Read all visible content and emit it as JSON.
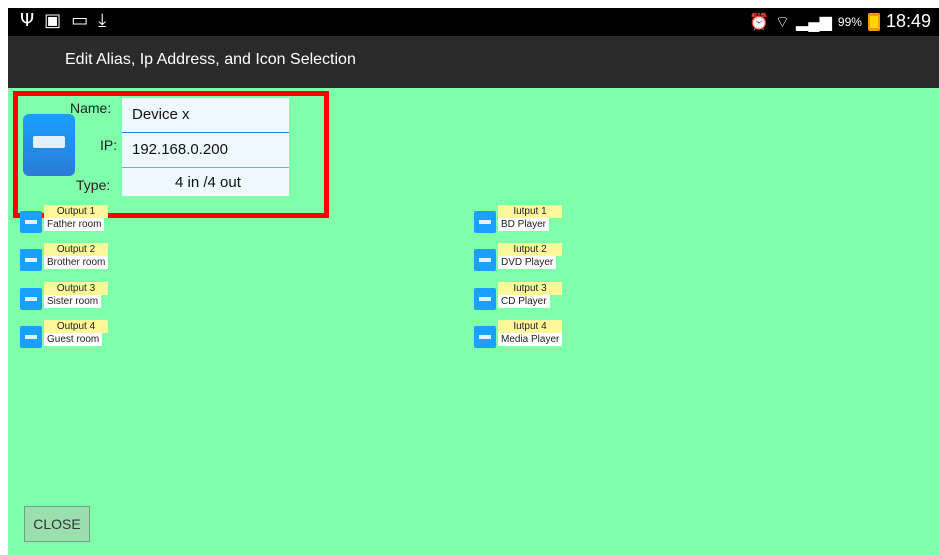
{
  "statusbar": {
    "left_icons": [
      "usb-icon",
      "notification-icon",
      "image-icon",
      "download-icon"
    ],
    "alarm_icon": "alarm-icon",
    "wifi_icon": "wifi-icon",
    "signal_icon": "signal-icon",
    "battery_pct": "99%",
    "time": "18:49"
  },
  "titlebar": {
    "title": "Edit Alias, Ip Address, and Icon Selection"
  },
  "editor": {
    "name_label": "Name:",
    "name_value": "Device x",
    "ip_label": "IP:",
    "ip_value": "192.168.0.200",
    "type_label": "Type:",
    "type_value": "4 in /4 out"
  },
  "outputs": [
    {
      "label": "Output 1",
      "alias": "Father room"
    },
    {
      "label": "Output 2",
      "alias": "Brother room"
    },
    {
      "label": "Output 3",
      "alias": "Sister room"
    },
    {
      "label": "Output 4",
      "alias": "Guest room"
    }
  ],
  "inputs": [
    {
      "label": "Iutput 1",
      "alias": "BD Player"
    },
    {
      "label": "Iutput 2",
      "alias": "DVD Player"
    },
    {
      "label": "Iutput 3",
      "alias": "CD Player"
    },
    {
      "label": "Iutput 4",
      "alias": "Media Player"
    }
  ],
  "close_label": "CLOSE",
  "colors": {
    "background": "#80ffaa",
    "highlight": "#ff0000",
    "accent": "#2a7bd6"
  }
}
